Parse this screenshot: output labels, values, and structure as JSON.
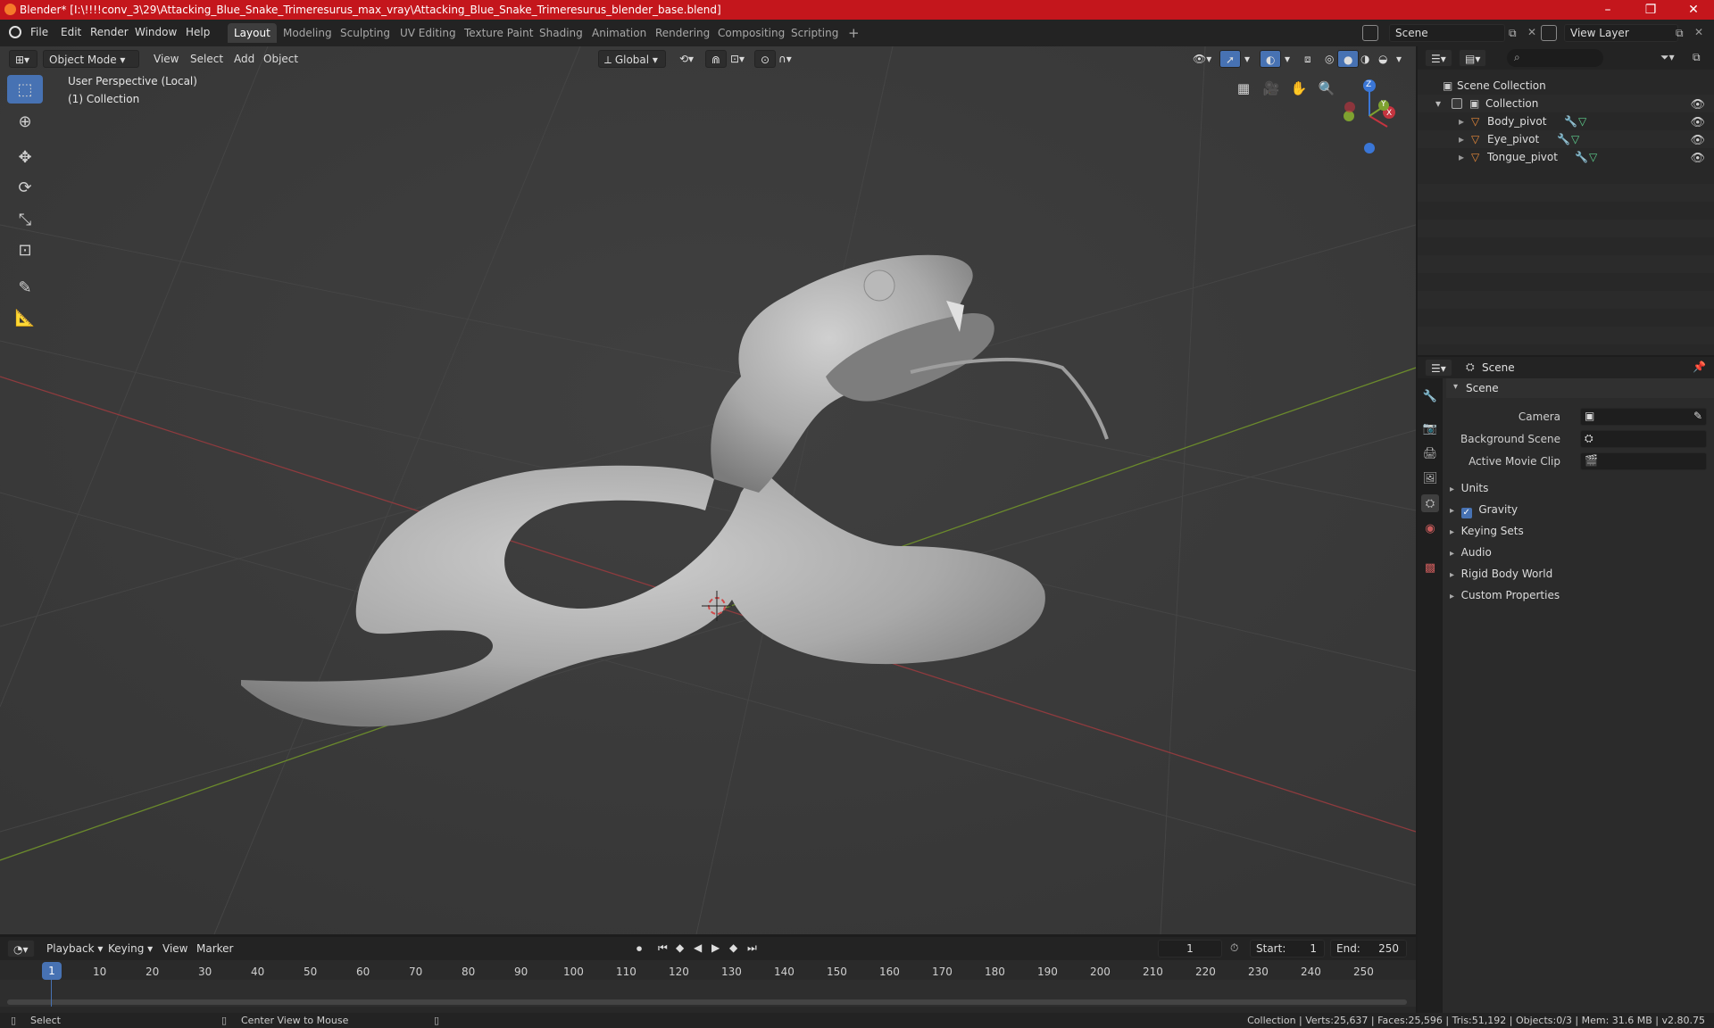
{
  "window": {
    "title": "Blender* [I:\\!!!!conv_3\\29\\Attacking_Blue_Snake_Trimeresurus_max_vray\\Attacking_Blue_Snake_Trimeresurus_blender_base.blend]",
    "minimize": "–",
    "maximize": "❐",
    "close": "✕"
  },
  "menubar": {
    "menus": [
      "File",
      "Edit",
      "Render",
      "Window",
      "Help"
    ],
    "workspaces": [
      "Layout",
      "Modeling",
      "Sculpting",
      "UV Editing",
      "Texture Paint",
      "Shading",
      "Animation",
      "Rendering",
      "Compositing",
      "Scripting"
    ],
    "active_workspace": "Layout",
    "add_workspace": "+",
    "scene_value": "Scene",
    "view_layer_value": "View Layer"
  },
  "viewport_header": {
    "mode": "Object Mode",
    "menus": [
      "View",
      "Select",
      "Add",
      "Object"
    ],
    "transform_orientation": "Global"
  },
  "viewport": {
    "perspective_label": "User Perspective (Local)",
    "collection_label": "(1) Collection",
    "gizmo_axes": {
      "z": "Z",
      "y": "Y",
      "x": "X"
    }
  },
  "outliner": {
    "search_placeholder": "",
    "root": "Scene Collection",
    "collection": "Collection",
    "objects": [
      "Body_pivot",
      "Eye_pivot",
      "Tongue_pivot"
    ]
  },
  "properties": {
    "header": "Scene",
    "panel_title": "Scene",
    "fields": [
      {
        "label": "Camera",
        "value": ""
      },
      {
        "label": "Background Scene",
        "value": ""
      },
      {
        "label": "Active Movie Clip",
        "value": ""
      }
    ],
    "sections": [
      "Units",
      "Gravity",
      "Keying Sets",
      "Audio",
      "Rigid Body World",
      "Custom Properties"
    ],
    "gravity_checked": true
  },
  "timeline": {
    "menus": [
      "Playback",
      "Keying",
      "View",
      "Marker"
    ],
    "current_frame": "1",
    "start_label": "Start:",
    "start_value": "1",
    "end_label": "End:",
    "end_value": "250",
    "ruler": [
      "1",
      "10",
      "20",
      "30",
      "40",
      "50",
      "60",
      "70",
      "80",
      "90",
      "100",
      "110",
      "120",
      "130",
      "140",
      "150",
      "160",
      "170",
      "180",
      "190",
      "200",
      "210",
      "220",
      "230",
      "240",
      "250"
    ]
  },
  "statusbar": {
    "left_action": "Select",
    "middle_action": "Center View to Mouse",
    "stats": "Collection | Verts:25,637 | Faces:25,596 | Tris:51,192 | Objects:0/3 | Mem: 31.6 MB | v2.80.75"
  },
  "colors": {
    "titlebar": "#c4161c",
    "accent": "#4772b3",
    "object_orange": "#e8893a",
    "modifier_blue": "#6aa8ff",
    "mesh_green": "#5fd18f",
    "axis_x": "#c4343f",
    "axis_y": "#7ea130",
    "axis_z": "#3a76d6"
  }
}
